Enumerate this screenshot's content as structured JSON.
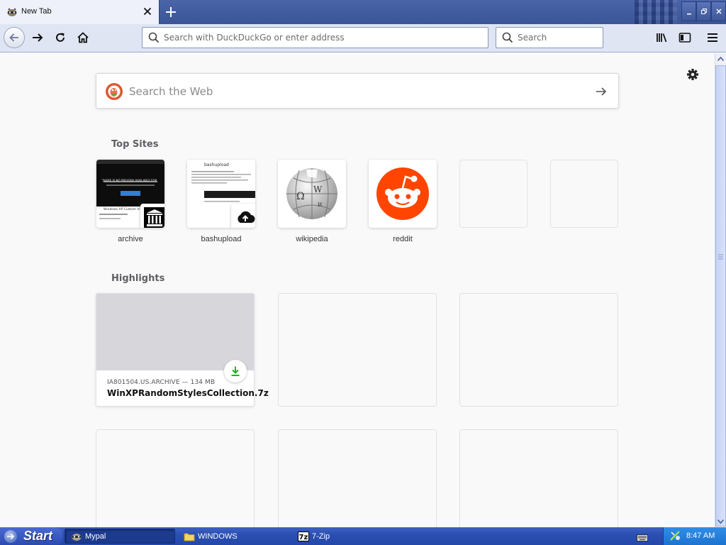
{
  "browser": {
    "tab": {
      "title": "New Tab"
    },
    "url_bar": {
      "placeholder": "Search with DuckDuckGo or enter address"
    },
    "search_bar": {
      "placeholder": "Search"
    }
  },
  "content": {
    "web_search": {
      "placeholder": "Search the Web"
    },
    "top_sites": {
      "title": "Top Sites",
      "items": [
        {
          "label": "archive",
          "thumb": "THERE IS NO PREVIEW AVAILABLE FOR",
          "thumb_caption": "Windows XP Custom Vi..."
        },
        {
          "label": "bashupload",
          "thumb": "bashupload"
        },
        {
          "label": "wikipedia"
        },
        {
          "label": "reddit"
        },
        {
          "label": ""
        },
        {
          "label": ""
        }
      ]
    },
    "highlights": {
      "title": "Highlights",
      "items": [
        {
          "source": "IA801504.US.ARCHIVE — 134 MB",
          "name": "WinXPRandomStylesCollection.7z"
        }
      ]
    }
  },
  "taskbar": {
    "start_label": "Start",
    "tasks": [
      {
        "label": "Mypal",
        "active": true
      },
      {
        "label": "WINDOWS",
        "active": false
      },
      {
        "label": "7-Zip",
        "active": false
      }
    ],
    "clock": "8:47 AM"
  },
  "colors": {
    "titlebar": "#3a5597",
    "toolbar": "#dfe5f3",
    "content_bg": "#f9f9fa",
    "reddit_orange": "#ff4500",
    "download_green": "#12bc00",
    "taskbar": "#2b4fb2",
    "tray": "#1d73d0"
  }
}
